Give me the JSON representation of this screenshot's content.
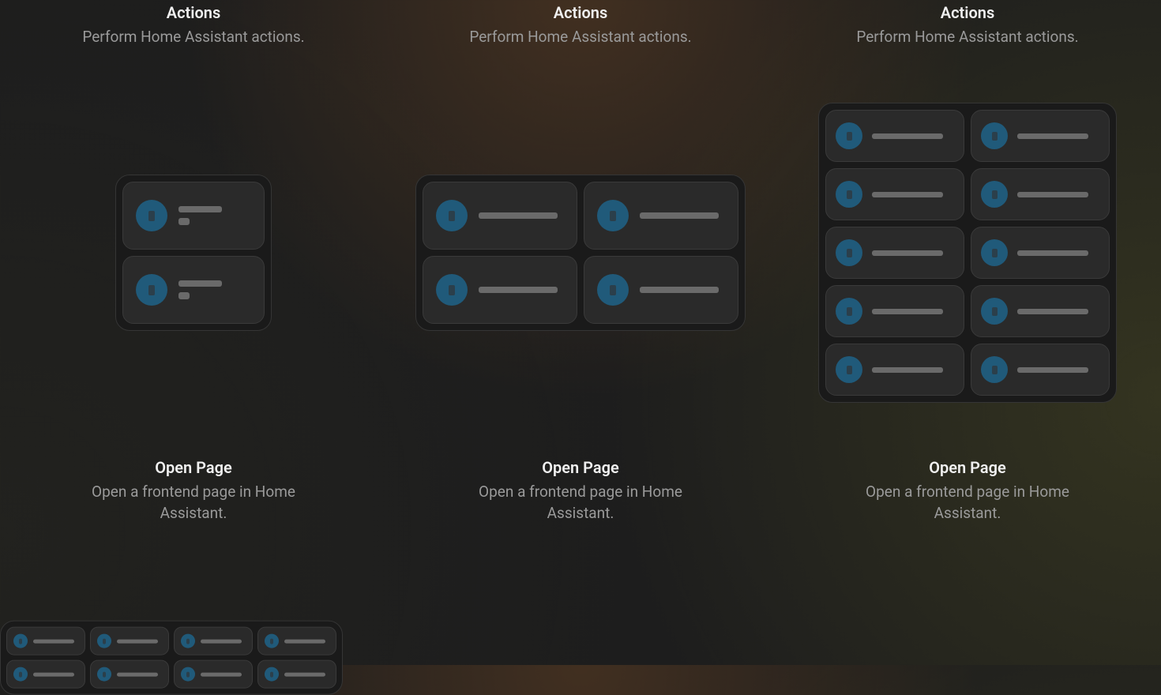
{
  "cards": {
    "actions": {
      "title": "Actions",
      "sub": "Perform Home Assistant actions."
    },
    "openPage": {
      "title": "Open Page",
      "sub": "Open a frontend page in Home Assistant."
    }
  }
}
